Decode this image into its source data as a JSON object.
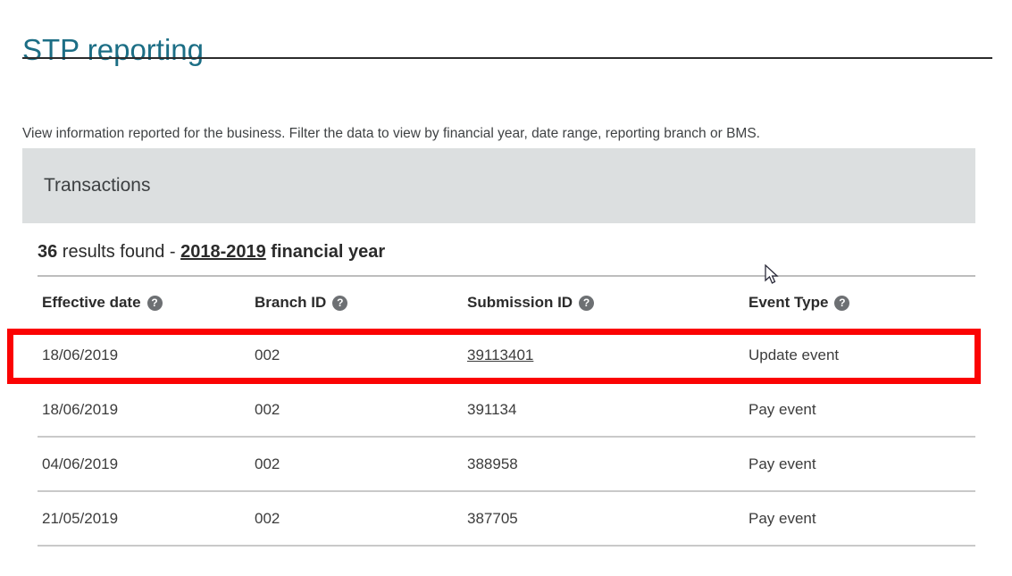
{
  "page": {
    "title": "STP reporting",
    "intro": "View information reported for the business. Filter the data to view by financial year, date range, reporting branch or BMS."
  },
  "panel": {
    "title": "Transactions"
  },
  "results": {
    "count": "36",
    "middle": " results found - ",
    "financial_year": "2018-2019",
    "suffix": " financial year"
  },
  "table": {
    "help_icon_glyph": "?",
    "columns": [
      {
        "label": "Effective date",
        "help": "help-icon"
      },
      {
        "label": "Branch ID",
        "help": "help-icon"
      },
      {
        "label": "Submission ID",
        "help": "help-icon"
      },
      {
        "label": "Event Type",
        "help": "help-icon"
      }
    ],
    "rows": [
      {
        "effective_date": "18/06/2019",
        "branch_id": "002",
        "submission_id": "39113401",
        "submission_is_link": true,
        "event_type": "Update event",
        "highlighted": true
      },
      {
        "effective_date": "18/06/2019",
        "branch_id": "002",
        "submission_id": "391134",
        "submission_is_link": false,
        "event_type": "Pay event",
        "highlighted": false
      },
      {
        "effective_date": "04/06/2019",
        "branch_id": "002",
        "submission_id": "388958",
        "submission_is_link": false,
        "event_type": "Pay event",
        "highlighted": false
      },
      {
        "effective_date": "21/05/2019",
        "branch_id": "002",
        "submission_id": "387705",
        "submission_is_link": false,
        "event_type": "Pay event",
        "highlighted": false
      }
    ]
  },
  "colors": {
    "title_teal": "#1c6e85",
    "panel_gray": "#dcdfe0",
    "annotation_red": "#fb0303",
    "help_icon_gray": "#6d7073",
    "rule_gray": "#c9c9c9"
  },
  "cursor": {
    "icon": "arrow-pointer-cursor"
  }
}
